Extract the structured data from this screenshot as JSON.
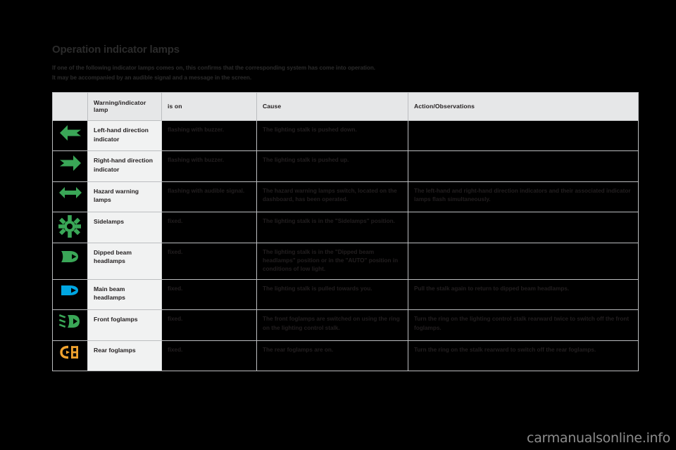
{
  "document": {
    "title": "Operation indicator lamps",
    "intro_lines": [
      "If one of the following indicator lamps comes on, this confirms that the corresponding system has come into operation.",
      "It may be accompanied by an audible signal and a message in the screen."
    ],
    "watermark": "carmanualsonline.info"
  },
  "colors": {
    "green": "#3aa757",
    "blue": "#00a6e2",
    "amber": "#f0a22e",
    "header_bg": "#e6e7e8",
    "lamp_bg": "#f1f2f2",
    "border": "#bcbec0",
    "page_bg": "#000000",
    "text": "#231f20"
  },
  "table": {
    "headers": [
      "",
      "Warning/indicator lamp",
      "is on",
      "Cause",
      "Action/Observations"
    ],
    "rows": [
      {
        "icon": "left-arrow-indicator-icon",
        "icon_color": "#3aa757",
        "lamp": "Left-hand direction indicator",
        "is_on": "flashing with buzzer.",
        "cause": "The lighting stalk is pushed down.",
        "action": ""
      },
      {
        "icon": "right-arrow-indicator-icon",
        "icon_color": "#3aa757",
        "lamp": "Right-hand direction indicator",
        "is_on": "flashing with buzzer.",
        "cause": "The lighting stalk is pushed up.",
        "action": ""
      },
      {
        "icon": "hazard-double-arrow-icon",
        "icon_color": "#3aa757",
        "lamp": "Hazard warning lamps",
        "is_on": "flashing with audible signal.",
        "cause": "The hazard warning lamps switch, located on the dashboard, has been operated.",
        "action": "The left-hand and right-hand direction indicators and their associated indicator lamps flash simultaneously."
      },
      {
        "icon": "sidelamps-icon",
        "icon_color": "#3aa757",
        "lamp": "Sidelamps",
        "is_on": "fixed.",
        "cause": "The lighting stalk is in the \"Sidelamps\" position.",
        "action": ""
      },
      {
        "icon": "dipped-beam-headlamps-icon",
        "icon_color": "#3aa757",
        "lamp": "Dipped beam headlamps",
        "is_on": "fixed.",
        "cause": "The lighting stalk is in the \"Dipped beam headlamps\" position or in the \"AUTO\" position in conditions of low light.",
        "action": ""
      },
      {
        "icon": "main-beam-headlamps-icon",
        "icon_color": "#00a6e2",
        "lamp": "Main beam headlamps",
        "is_on": "fixed.",
        "cause": "The lighting stalk is pulled towards you.",
        "action": "Pull the stalk again to return to dipped beam headlamps."
      },
      {
        "icon": "front-foglamps-icon",
        "icon_color": "#3aa757",
        "lamp": "Front foglamps",
        "is_on": "fixed.",
        "cause": "The front foglamps are switched on using the ring on the lighting control stalk.",
        "action": "Turn the ring on the lighting control stalk rearward twice to switch off the front foglamps."
      },
      {
        "icon": "rear-foglamps-icon",
        "icon_color": "#f0a22e",
        "lamp": "Rear foglamps",
        "is_on": "fixed.",
        "cause": "The rear foglamps are on.",
        "action": "Turn the ring on the stalk rearward to switch off the rear foglamps."
      }
    ]
  }
}
